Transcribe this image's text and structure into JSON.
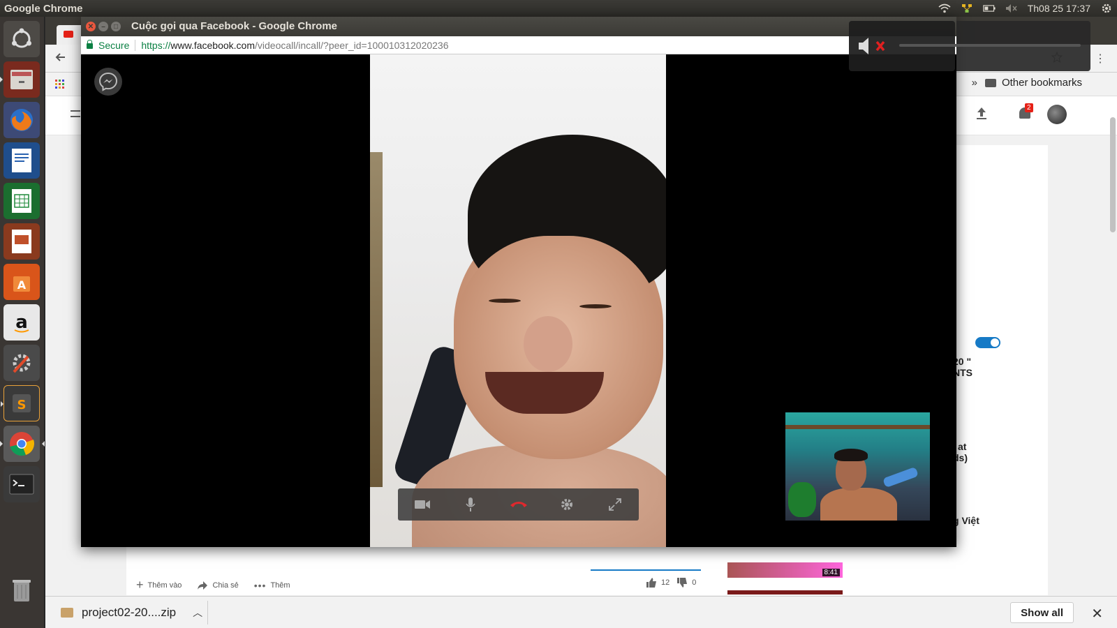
{
  "panel": {
    "app_name": "Google Chrome",
    "clock": "Th08 25 17:37"
  },
  "launcher": {
    "items": [
      {
        "name": "ubuntu-dash",
        "color": "#6b6b6b"
      },
      {
        "name": "files",
        "color": "#c0392b"
      },
      {
        "name": "firefox",
        "color": "#e66000"
      },
      {
        "name": "libreoffice-writer",
        "color": "#2a62b0"
      },
      {
        "name": "libreoffice-calc",
        "color": "#1e8a3a"
      },
      {
        "name": "libreoffice-impress",
        "color": "#c0502a"
      },
      {
        "name": "ubuntu-software",
        "color": "#e0661d"
      },
      {
        "name": "amazon",
        "color": "#333333"
      },
      {
        "name": "system-settings",
        "color": "#555555"
      },
      {
        "name": "sublime-text",
        "color": "#444444"
      },
      {
        "name": "google-chrome",
        "color": "#4a4a4a"
      },
      {
        "name": "terminal",
        "color": "#2b2b2b"
      }
    ]
  },
  "bg_browser": {
    "bookmarks_overflow": "»",
    "other_bookmarks": "Other bookmarks",
    "notification_count": "2",
    "side_text_1": "20 \"",
    "side_text_2": "NTS",
    "side_text_3": "at",
    "side_text_4": "ds)",
    "side_text_5": "g Việt",
    "actions": {
      "add": "Thêm vào",
      "share": "Chia sẻ",
      "more": "Thêm"
    },
    "likes": "12",
    "dislikes": "0",
    "thumb_duration": "8:41"
  },
  "download_bar": {
    "file_name": "project02-20....zip",
    "show_all": "Show all",
    "close": "✕"
  },
  "call_window": {
    "title": "Cuộc gọi qua Facebook - Google Chrome",
    "secure_label": "Secure",
    "url_scheme": "https://",
    "url_host": "www.facebook.com",
    "url_path": "/videocall/incall/?peer_id=100010312020236"
  },
  "colors": {
    "accent_blue": "#167ac6",
    "secure_green": "#0b8043",
    "hangup_red": "#e0282d",
    "close_orange": "#e9573e"
  }
}
